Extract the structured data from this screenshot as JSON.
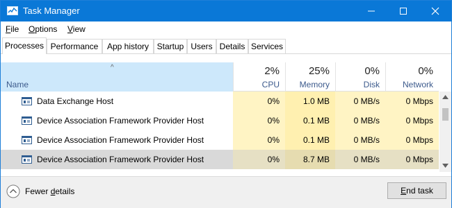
{
  "window": {
    "title": "Task Manager"
  },
  "menu": {
    "file_u": "F",
    "file_rest": "ile",
    "options_u": "O",
    "options_rest": "ptions",
    "view_u": "V",
    "view_rest": "iew"
  },
  "tabs": [
    "Processes",
    "Performance",
    "App history",
    "Startup",
    "Users",
    "Details",
    "Services"
  ],
  "columns": {
    "name": "Name",
    "cpu": {
      "pct": "2%",
      "label": "CPU"
    },
    "memory": {
      "pct": "25%",
      "label": "Memory"
    },
    "disk": {
      "pct": "0%",
      "label": "Disk"
    },
    "network": {
      "pct": "0%",
      "label": "Network"
    }
  },
  "rows": [
    {
      "name": "Data Exchange Host",
      "cpu": "0%",
      "memory": "1.0 MB",
      "disk": "0 MB/s",
      "network": "0 Mbps"
    },
    {
      "name": "Device Association Framework Provider Host",
      "cpu": "0%",
      "memory": "0.1 MB",
      "disk": "0 MB/s",
      "network": "0 Mbps"
    },
    {
      "name": "Device Association Framework Provider Host",
      "cpu": "0%",
      "memory": "0.1 MB",
      "disk": "0 MB/s",
      "network": "0 Mbps"
    },
    {
      "name": "Device Association Framework Provider Host",
      "cpu": "0%",
      "memory": "8.7 MB",
      "disk": "0 MB/s",
      "network": "0 Mbps"
    }
  ],
  "footer": {
    "fewer_pre": "Fewer ",
    "fewer_u": "d",
    "fewer_rest": "etails",
    "end_u": "E",
    "end_rest": "nd task"
  },
  "colors": {
    "titlebar": "#0a78d7",
    "name_header": "#cde8fb",
    "cpu_fill": "#fff4c4",
    "memory_fill": "#fff0b0",
    "selected_row": "#d9d9d9"
  }
}
